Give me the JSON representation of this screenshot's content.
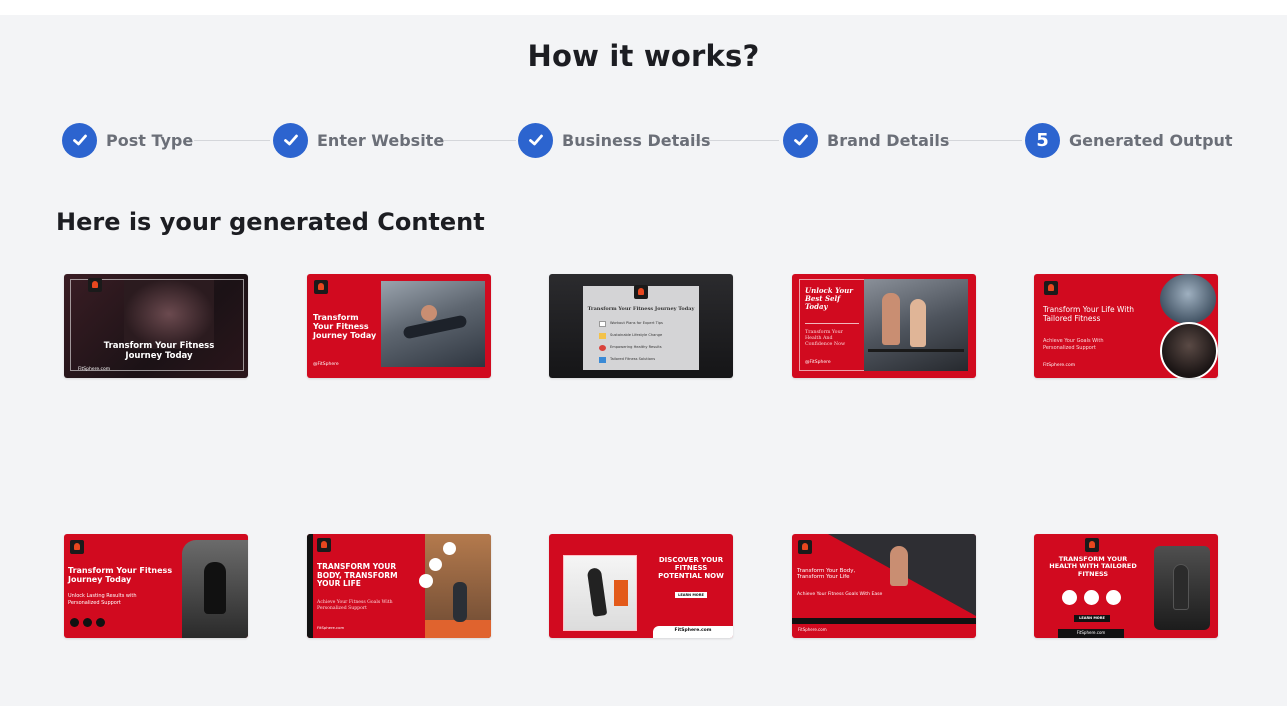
{
  "header": {
    "title": "How it works?"
  },
  "steps": [
    {
      "label": "Post Type",
      "state": "complete",
      "icon": "check-icon"
    },
    {
      "label": "Enter Website",
      "state": "complete",
      "icon": "check-icon"
    },
    {
      "label": "Business Details",
      "state": "complete",
      "icon": "check-icon"
    },
    {
      "label": "Brand Details",
      "state": "complete",
      "icon": "check-icon"
    },
    {
      "label": "Generated Output",
      "state": "current",
      "number": "5"
    }
  ],
  "content": {
    "heading": "Here is your generated Content"
  },
  "cards": [
    {
      "title": "Transform Your Fitness Journey Today",
      "footer": "FitSphere.com"
    },
    {
      "title": "Transform Your Fitness Journey Today",
      "footer": "@FitSphere"
    },
    {
      "title": "Transform Your Fitness Journey Today",
      "items": [
        "Workout Plans for Expert Tips",
        "Sustainable Lifestyle Change",
        "Empowering Healthy Results",
        "Tailored Fitness Solutions"
      ]
    },
    {
      "title": "Unlock Your Best Self Today",
      "subtitle": "Transform Your Health And Confidence Now",
      "footer": "@FitSphere"
    },
    {
      "title": "Transform Your Life With Tailored Fitness",
      "subtitle": "Achieve Your Goals With Personalized Support",
      "footer": "FitSphere.com"
    },
    {
      "title": "Transform Your Fitness Journey Today",
      "subtitle": "Unlock Lasting Results with Personalized Support"
    },
    {
      "title": "TRANSFORM YOUR BODY, TRANSFORM YOUR LIFE",
      "subtitle": "Achieve Your Fitness Goals With Personalized Support",
      "footer": "FitSphere.com"
    },
    {
      "title": "DISCOVER YOUR FITNESS POTENTIAL NOW",
      "button": "LEARN MORE",
      "footer": "FitSphere.com"
    },
    {
      "title": "Transform Your Body, Transform Your Life",
      "subtitle": "Achieve Your Fitness Goals With Ease",
      "footer": "FitSphere.com"
    },
    {
      "title": "TRANSFORM YOUR HEALTH WITH TAILORED FITNESS",
      "button": "LEARN MORE",
      "footer": "FitSphere.com"
    }
  ],
  "colors": {
    "accent": "#2c64cf",
    "brand_red": "#d10a1f",
    "background": "#f3f4f6"
  }
}
